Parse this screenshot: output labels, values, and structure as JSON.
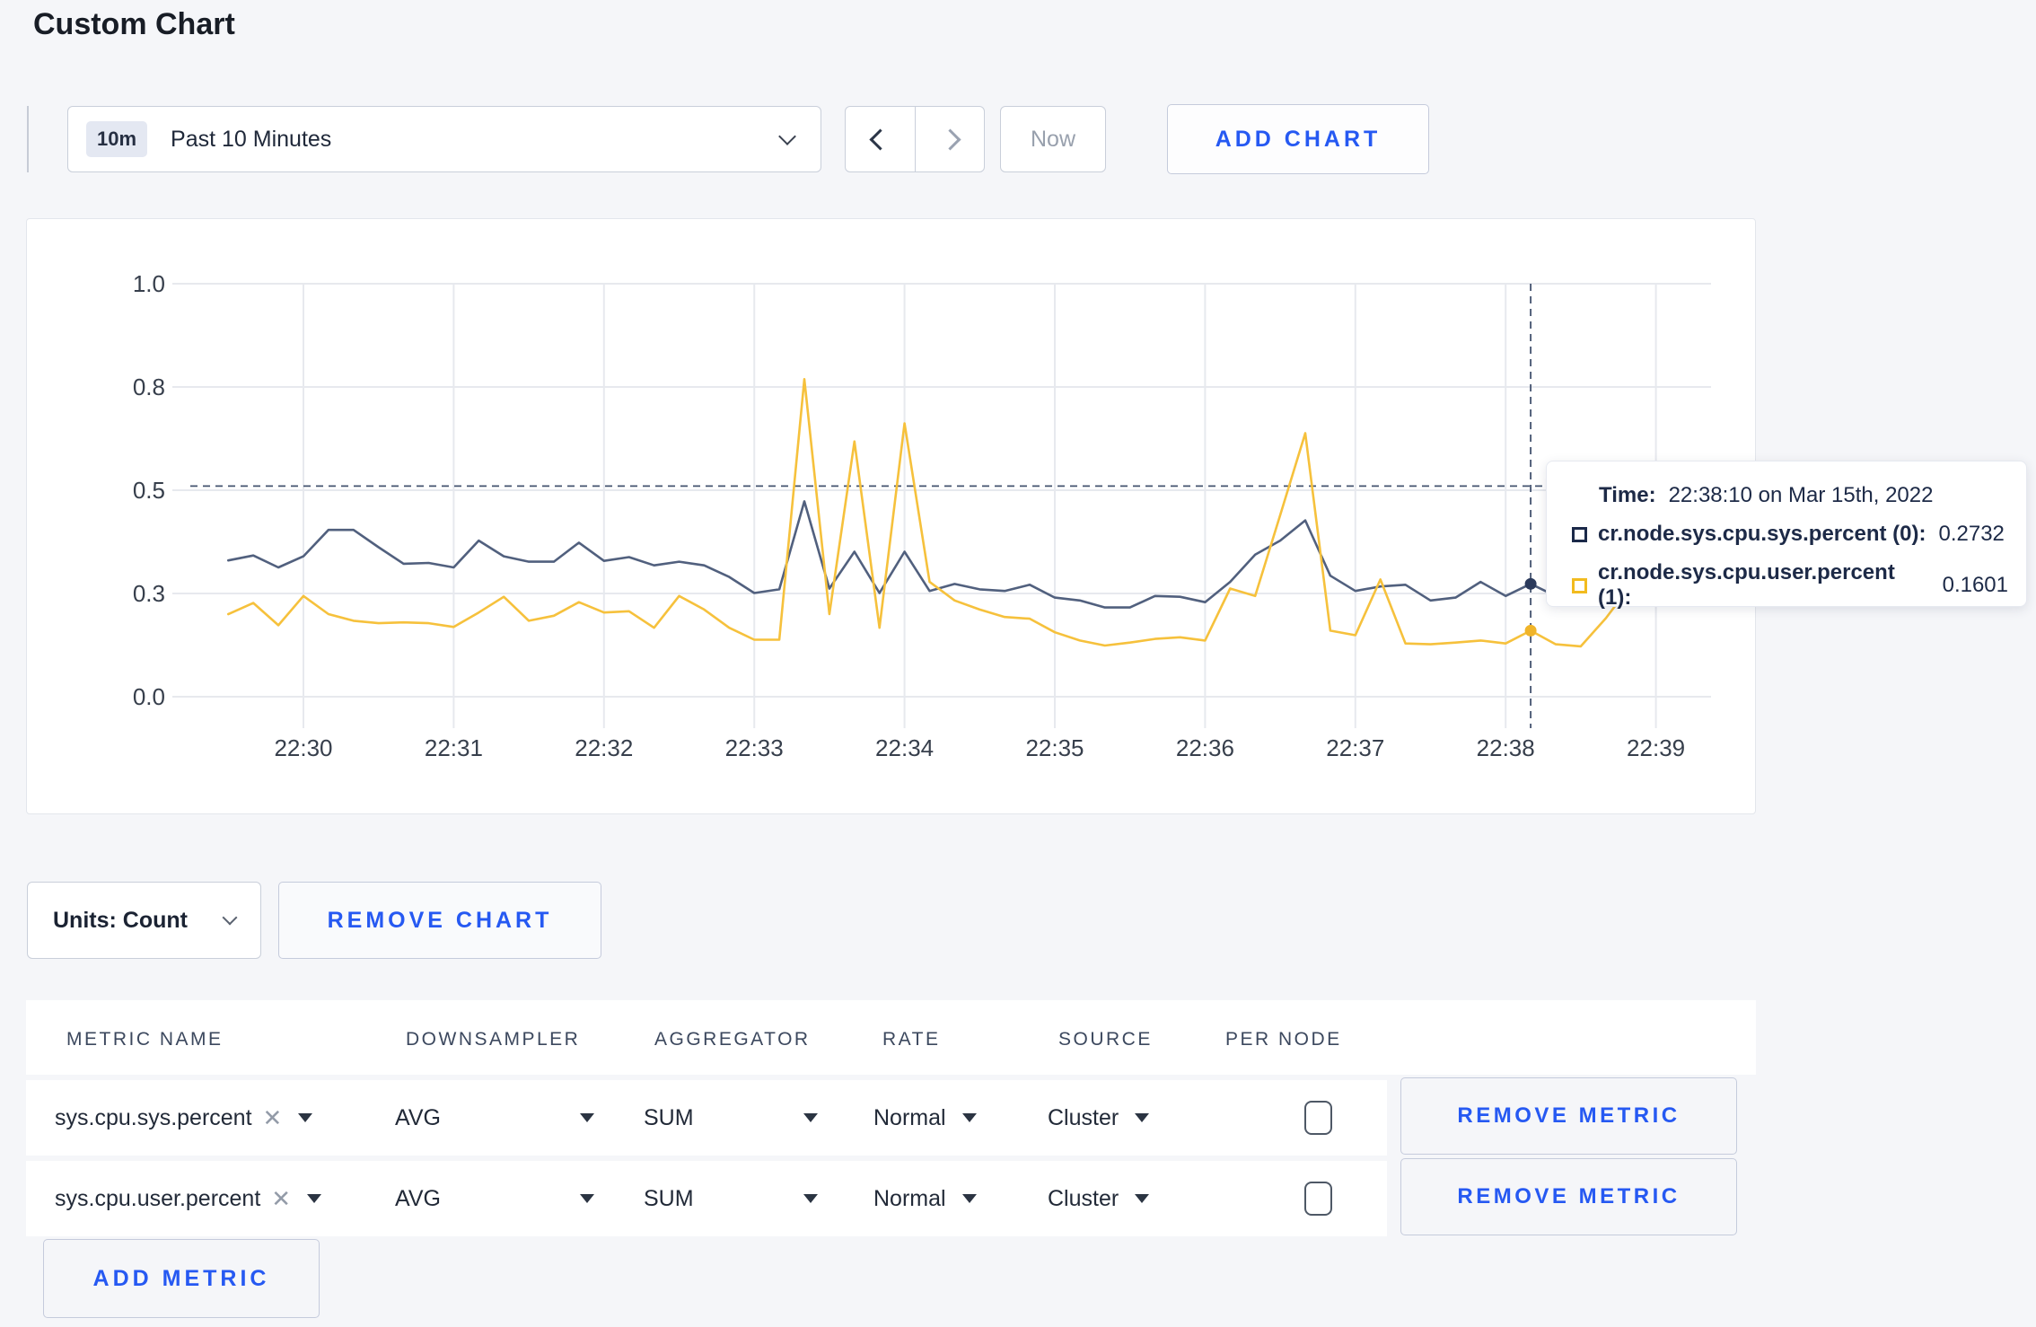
{
  "page": {
    "title": "Custom Chart"
  },
  "toolbar": {
    "time_badge": "10m",
    "time_label": "Past 10 Minutes",
    "now_label": "Now",
    "add_chart_label": "ADD CHART"
  },
  "chart_actions": {
    "units_label": "Units: Count",
    "remove_chart_label": "REMOVE CHART",
    "add_metric_label": "ADD METRIC"
  },
  "tooltip": {
    "time_label": "Time:",
    "time_value": "22:38:10 on Mar 15th, 2022",
    "series": [
      {
        "label": "cr.node.sys.cpu.sys.percent (0):",
        "value": "0.2732",
        "color": "#1b2949"
      },
      {
        "label": "cr.node.sys.cpu.user.percent (1):",
        "value": "0.1601",
        "color": "#f2bb1f"
      }
    ]
  },
  "chart_data": {
    "type": "line",
    "title": "",
    "xlabel": "",
    "ylabel": "",
    "ylim": [
      0,
      1
    ],
    "grid": true,
    "start_time": "22:29:30",
    "interval_seconds": 10,
    "x_ticks": [
      "22:30",
      "22:31",
      "22:32",
      "22:33",
      "22:34",
      "22:35",
      "22:36",
      "22:37",
      "22:38",
      "22:39"
    ],
    "y_ticks": [
      {
        "label": "0.0",
        "value": 0
      },
      {
        "label": "0.3",
        "value": 0.25
      },
      {
        "label": "0.5",
        "value": 0.5
      },
      {
        "label": "0.8",
        "value": 0.75
      },
      {
        "label": "1.0",
        "value": 1
      }
    ],
    "series": [
      {
        "name": "cr.node.sys.cpu.sys.percent",
        "color": "#51607e",
        "values": [
          0.33,
          0.342,
          0.313,
          0.34,
          0.404,
          0.404,
          0.362,
          0.322,
          0.324,
          0.313,
          0.378,
          0.34,
          0.327,
          0.327,
          0.373,
          0.329,
          0.338,
          0.318,
          0.327,
          0.318,
          0.29,
          0.251,
          0.26,
          0.473,
          0.262,
          0.351,
          0.251,
          0.351,
          0.256,
          0.273,
          0.26,
          0.256,
          0.271,
          0.24,
          0.233,
          0.216,
          0.216,
          0.244,
          0.242,
          0.229,
          0.278,
          0.344,
          0.378,
          0.427,
          0.293,
          0.256,
          0.267,
          0.271,
          0.233,
          0.24,
          0.278,
          0.244,
          0.2732,
          0.244,
          0.238,
          0.267,
          0.311,
          0.296,
          0.311
        ]
      },
      {
        "name": "cr.node.sys.cpu.user.percent",
        "color": "#f6c13c",
        "values": [
          0.2,
          0.227,
          0.173,
          0.244,
          0.2,
          0.184,
          0.178,
          0.18,
          0.178,
          0.169,
          0.204,
          0.242,
          0.184,
          0.196,
          0.229,
          0.204,
          0.207,
          0.167,
          0.244,
          0.211,
          0.167,
          0.138,
          0.138,
          0.769,
          0.2,
          0.618,
          0.167,
          0.662,
          0.278,
          0.233,
          0.211,
          0.193,
          0.189,
          0.156,
          0.136,
          0.124,
          0.131,
          0.14,
          0.144,
          0.136,
          0.262,
          0.244,
          0.44,
          0.638,
          0.16,
          0.149,
          0.284,
          0.129,
          0.127,
          0.131,
          0.136,
          0.129,
          0.1601,
          0.127,
          0.122,
          0.19,
          0.27,
          0.273,
          0.249
        ]
      }
    ],
    "hover": {
      "time": "22:38:10",
      "index": 52,
      "pointer_value": 0.51,
      "values": [
        0.2732,
        0.1601
      ],
      "dot_colors": [
        "#2b3a5c",
        "#f0b429"
      ]
    },
    "colors": {
      "gridline": "#e7e9ee",
      "crosshair": "#44536f",
      "tick_text": "#373f4c"
    }
  },
  "metrics_table": {
    "headers": [
      "METRIC NAME",
      "DOWNSAMPLER",
      "AGGREGATOR",
      "RATE",
      "SOURCE",
      "PER NODE"
    ],
    "remove_metric_label": "REMOVE METRIC",
    "rows": [
      {
        "metric_name": "sys.cpu.sys.percent",
        "remove_icon": "✕",
        "downsampler": "AVG",
        "aggregator": "SUM",
        "rate": "Normal",
        "source": "Cluster",
        "per_node": false
      },
      {
        "metric_name": "sys.cpu.user.percent",
        "remove_icon": "✕",
        "downsampler": "AVG",
        "aggregator": "SUM",
        "rate": "Normal",
        "source": "Cluster",
        "per_node": false
      }
    ]
  }
}
